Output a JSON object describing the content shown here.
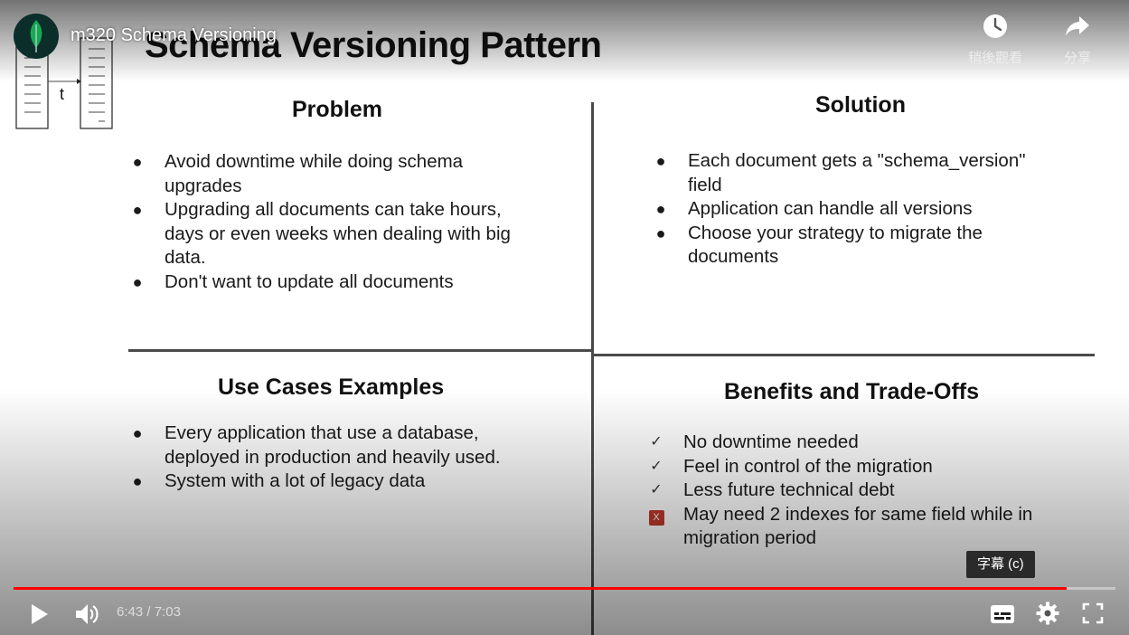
{
  "video": {
    "title": "m320 Schema Versioning",
    "actions": [
      {
        "label": "稍後觀看",
        "icon": "clock-icon"
      },
      {
        "label": "分享",
        "icon": "share-icon"
      }
    ],
    "progress": 0.956,
    "time_current": "6:43",
    "time_separator": " / ",
    "time_total": "7:03",
    "tooltip": "字幕 (c)",
    "colors": {
      "progress": "#ff0000",
      "avatar_bg": "#0b2e2b",
      "leaf": "#13aa52"
    }
  },
  "slide": {
    "title": "Schema Versioning Pattern",
    "logo_label": "t",
    "problem": {
      "heading": "Problem",
      "items": [
        [
          "Avoid downtime while doing schema",
          "upgrades"
        ],
        [
          "Upgrading all documents can take hours,",
          "days or even weeks when dealing with big",
          "data."
        ],
        [
          "Don't want to update all documents"
        ]
      ]
    },
    "solution": {
      "heading": "Solution",
      "items": [
        [
          "Each document gets a \"schema_version\"",
          "field"
        ],
        [
          "Application can handle all versions"
        ],
        [
          "Choose your strategy to migrate the",
          "documents"
        ]
      ]
    },
    "use_cases": {
      "heading": "Use Cases Examples",
      "items": [
        [
          "Every application that use a database,",
          "deployed in production and heavily used."
        ],
        [
          "System with a lot of legacy data"
        ]
      ]
    },
    "benefits": {
      "heading": "Benefits and Trade-Offs",
      "items": [
        {
          "mark": "check",
          "lines": [
            "No downtime needed"
          ]
        },
        {
          "mark": "check",
          "lines": [
            "Feel in control of the migration"
          ]
        },
        {
          "mark": "check",
          "lines": [
            "Less future technical debt"
          ]
        },
        {
          "mark": "x",
          "mark_text": "X",
          "lines": [
            "May need 2 indexes for same field while in",
            "migration period"
          ]
        }
      ]
    }
  }
}
